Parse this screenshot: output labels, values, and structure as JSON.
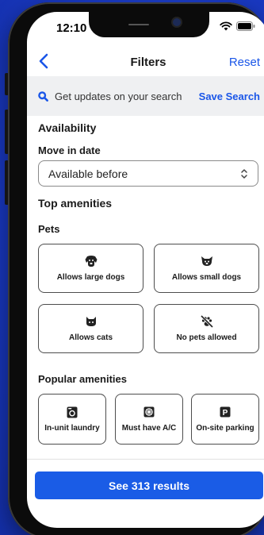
{
  "status_bar": {
    "time": "12:10"
  },
  "nav": {
    "title": "Filters",
    "reset_label": "Reset"
  },
  "saved_search": {
    "prompt": "Get updates on your search",
    "action_label": "Save Search"
  },
  "availability": {
    "heading": "Availability",
    "move_in_label": "Move in date",
    "move_in_value": "Available before"
  },
  "amenities": {
    "heading": "Top amenities",
    "pets_heading": "Pets",
    "pets": [
      {
        "label": "Allows large dogs",
        "icon": "large-dog-icon"
      },
      {
        "label": "Allows small dogs",
        "icon": "small-dog-icon"
      },
      {
        "label": "Allows cats",
        "icon": "cat-icon"
      },
      {
        "label": "No pets allowed",
        "icon": "no-pets-paw-icon"
      }
    ],
    "popular_heading": "Popular amenities",
    "popular": [
      {
        "label": "In-unit laundry",
        "icon": "washer-icon"
      },
      {
        "label": "Must have A/C",
        "icon": "ac-icon"
      },
      {
        "label": "On-site parking",
        "icon": "parking-icon"
      }
    ]
  },
  "footer": {
    "results_label": "See 313 results"
  },
  "colors": {
    "accent": "#1a56e8",
    "button": "#1a5ce6",
    "background": "#1a3bc9"
  }
}
